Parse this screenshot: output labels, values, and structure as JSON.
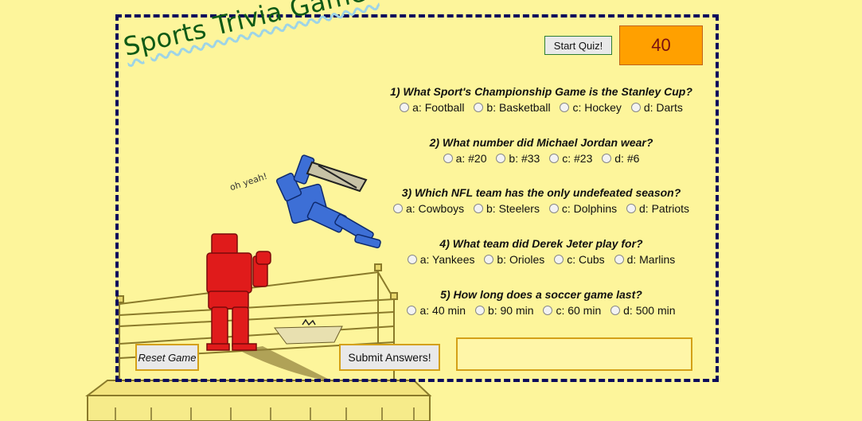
{
  "title": "Sports Trivia Game!",
  "start_button": "Start Quiz!",
  "timer": "40",
  "speech": "oh yeah!",
  "questions": [
    {
      "text": "1) What Sport's Championship Game is the Stanley Cup?",
      "options": [
        "a: Football",
        "b: Basketball",
        "c: Hockey",
        "d: Darts"
      ]
    },
    {
      "text": "2) What number did Michael Jordan wear?",
      "options": [
        "a: #20",
        "b: #33",
        "c: #23",
        "d: #6"
      ]
    },
    {
      "text": "3) Which NFL team has the only undefeated season?",
      "options": [
        "a: Cowboys",
        "b: Steelers",
        "c: Dolphins",
        "d: Patriots"
      ]
    },
    {
      "text": "4) What team did Derek Jeter play for?",
      "options": [
        "a: Yankees",
        "b: Orioles",
        "c: Cubs",
        "d: Marlins"
      ]
    },
    {
      "text": "5) How long does a soccer game last?",
      "options": [
        "a: 40 min",
        "b: 90 min",
        "c: 60 min",
        "d: 500 min"
      ]
    }
  ],
  "reset_button": "Reset Game",
  "submit_button": "Submit Answers!",
  "result_text": "",
  "colors": {
    "background": "#fdf59b",
    "frame": "#0b0b5c",
    "title": "#0e5a16",
    "timer_bg": "#ffa000",
    "red_robot": "#e01b1b",
    "blue_robot": "#3d6fd6"
  }
}
